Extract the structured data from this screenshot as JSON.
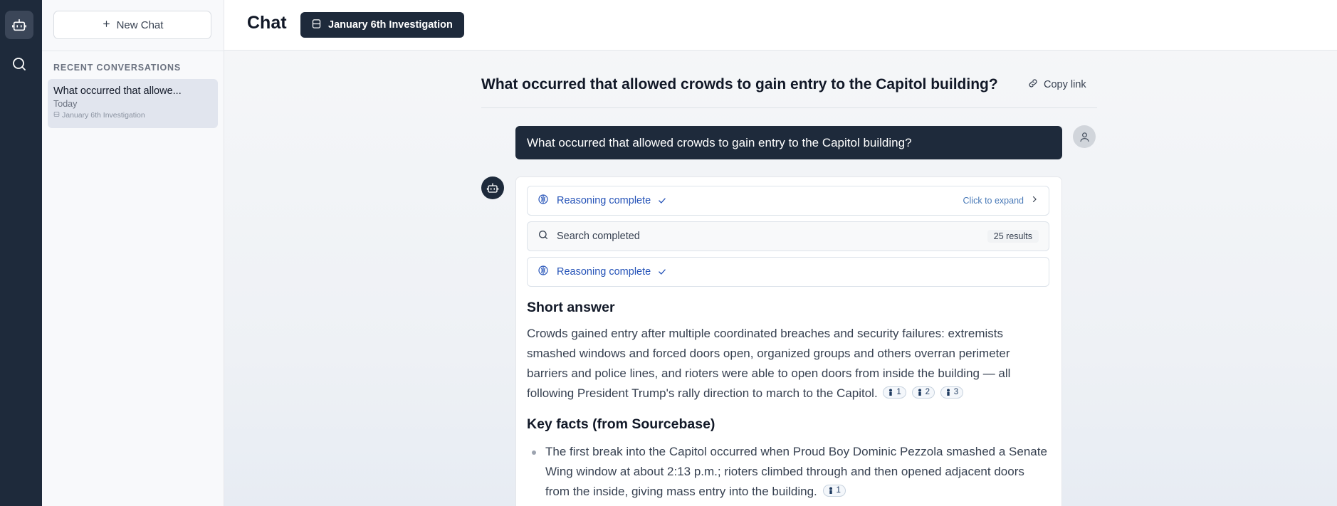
{
  "rail": {
    "icons": [
      "bot-icon",
      "search-icon"
    ]
  },
  "sidebar": {
    "new_chat": "New Chat",
    "recent_label": "RECENT CONVERSATIONS",
    "conversations": [
      {
        "title": "What occurred that allowe...",
        "date": "Today",
        "tag": "January 6th Investigation"
      }
    ]
  },
  "header": {
    "title": "Chat",
    "collection": "January 6th Investigation"
  },
  "thread": {
    "question_title": "What occurred that allowed crowds to gain entry to the Capitol building?",
    "copy_link": "Copy link",
    "user_message": "What occurred that allowed crowds to gain entry to the Capitol building?",
    "steps": {
      "reasoning1": "Reasoning complete",
      "expand": "Click to expand",
      "search": "Search completed",
      "results": "25 results",
      "reasoning2": "Reasoning complete"
    },
    "short_answer_heading": "Short answer",
    "short_answer": "Crowds gained entry after multiple coordinated breaches and security failures: extremists smashed windows and forced doors open, organized groups and others overran perimeter barriers and police lines, and rioters were able to open doors from inside the building — all following President Trump's rally direction to march to the Capitol.",
    "short_answer_citations": [
      "1",
      "2",
      "3"
    ],
    "key_facts_heading": "Key facts (from Sourcebase)",
    "key_facts": [
      {
        "text": "The first break into the Capitol occurred when Proud Boy Dominic Pezzola smashed a Senate Wing window at about 2:13 p.m.; rioters climbed through and then opened adjacent doors from the inside, giving mass entry into the building.",
        "citation": "1"
      }
    ]
  },
  "colors": {
    "rail": "#1e2a3b",
    "accent_blue": "#2553b8",
    "user_bubble": "#1e2a3b"
  }
}
